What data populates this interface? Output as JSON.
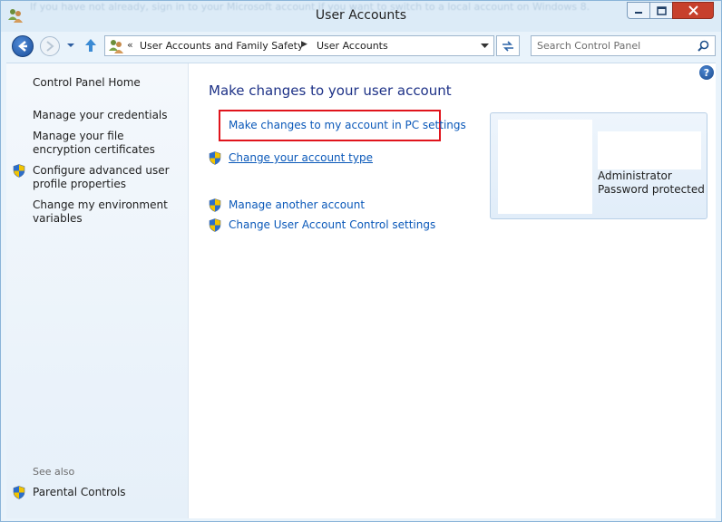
{
  "window": {
    "title": "User Accounts",
    "background_text": "If you have not already, sign in to your Microsoft account if you want to switch to a local account on Windows 8."
  },
  "navigation": {
    "breadcrumb": [
      "User Accounts and Family Safety",
      "User Accounts"
    ],
    "breadcrumb_overflow": "«",
    "search_placeholder": "Search Control Panel"
  },
  "sidebar": {
    "home": "Control Panel Home",
    "items": [
      {
        "label": "Manage your credentials",
        "icon": "none"
      },
      {
        "label": "Manage your file encryption certificates",
        "icon": "none"
      },
      {
        "label": "Configure advanced user profile properties",
        "icon": "shield-icon"
      },
      {
        "label": "Change my environment variables",
        "icon": "none"
      }
    ],
    "see_also_label": "See also",
    "see_also_items": [
      {
        "label": "Parental Controls",
        "icon": "shield-icon"
      }
    ]
  },
  "main": {
    "heading": "Make changes to your user account",
    "links": [
      {
        "label": "Make changes to my account in PC settings",
        "highlighted": true
      },
      {
        "label": "Change your account type",
        "icon": "shield-icon"
      },
      {
        "label": "Manage another account",
        "icon": "shield-icon"
      },
      {
        "label": "Change User Account Control settings",
        "icon": "shield-icon"
      }
    ],
    "help": "?"
  },
  "user_card": {
    "role": "Administrator",
    "status": "Password protected"
  },
  "colors": {
    "link": "#0a58b9",
    "heading": "#1e3287",
    "highlight_border": "#e0141c",
    "window_frame": "#dcebf7"
  }
}
